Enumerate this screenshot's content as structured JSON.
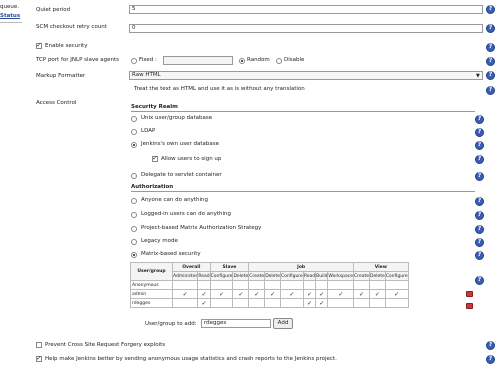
{
  "sidebar": {
    "queue_text": "queue.",
    "status_link": "Status"
  },
  "general": {
    "quiet_period_label": "Quiet period",
    "quiet_period_value": "5",
    "scm_retry_label": "SCM checkout retry count",
    "scm_retry_value": "0"
  },
  "security": {
    "enable_label": "Enable security",
    "tcp_label": "TCP port for JNLP slave agents",
    "tcp_options": [
      "Fixed :",
      "Random",
      "Disable"
    ],
    "markup_label": "Markup Formatter",
    "markup_value": "Raw HTML",
    "markup_desc": "Treat the text as HTML and use it as is without any translation",
    "access_control_label": "Access Control",
    "realm_heading": "Security Realm",
    "realm_options": [
      "Unix user/group database",
      "LDAP",
      "Jenkins's own user database",
      "Delegate to servlet container"
    ],
    "allow_signup_label": "Allow users to sign up",
    "authz_heading": "Authorization",
    "authz_options": [
      "Anyone can do anything",
      "Logged-in users can do anything",
      "Project-based Matrix Authorization Strategy",
      "Legacy mode",
      "Matrix-based security"
    ],
    "add_user_label": "User/group to add:",
    "add_user_value": "rdegges",
    "add_button": "Add",
    "csrf_label": "Prevent Cross Site Request Forgery exploits",
    "stats_label": "Help make Jenkins better by sending anonymous usage statistics and crash reports to the Jenkins project."
  },
  "matrix": {
    "user_header": "User/group",
    "groups": [
      {
        "name": "Overall",
        "perms": [
          "Administer",
          "Read"
        ]
      },
      {
        "name": "Slave",
        "perms": [
          "Configure",
          "Delete"
        ]
      },
      {
        "name": "Job",
        "perms": [
          "Create",
          "Delete",
          "Configure",
          "Read",
          "Build",
          "Workspace"
        ]
      },
      {
        "name": "View",
        "perms": [
          "Create",
          "Delete",
          "Configure"
        ]
      }
    ],
    "rows": [
      {
        "user": "Anonymous",
        "checks": [
          false,
          false,
          false,
          false,
          false,
          false,
          false,
          false,
          false,
          false,
          false,
          false,
          false
        ]
      },
      {
        "user": "admin",
        "checks": [
          true,
          true,
          true,
          true,
          true,
          true,
          true,
          true,
          true,
          true,
          true,
          true,
          true
        ]
      },
      {
        "user": "rdegges",
        "checks": [
          false,
          true,
          false,
          false,
          false,
          false,
          false,
          true,
          true,
          false,
          false,
          false,
          false
        ]
      }
    ]
  }
}
